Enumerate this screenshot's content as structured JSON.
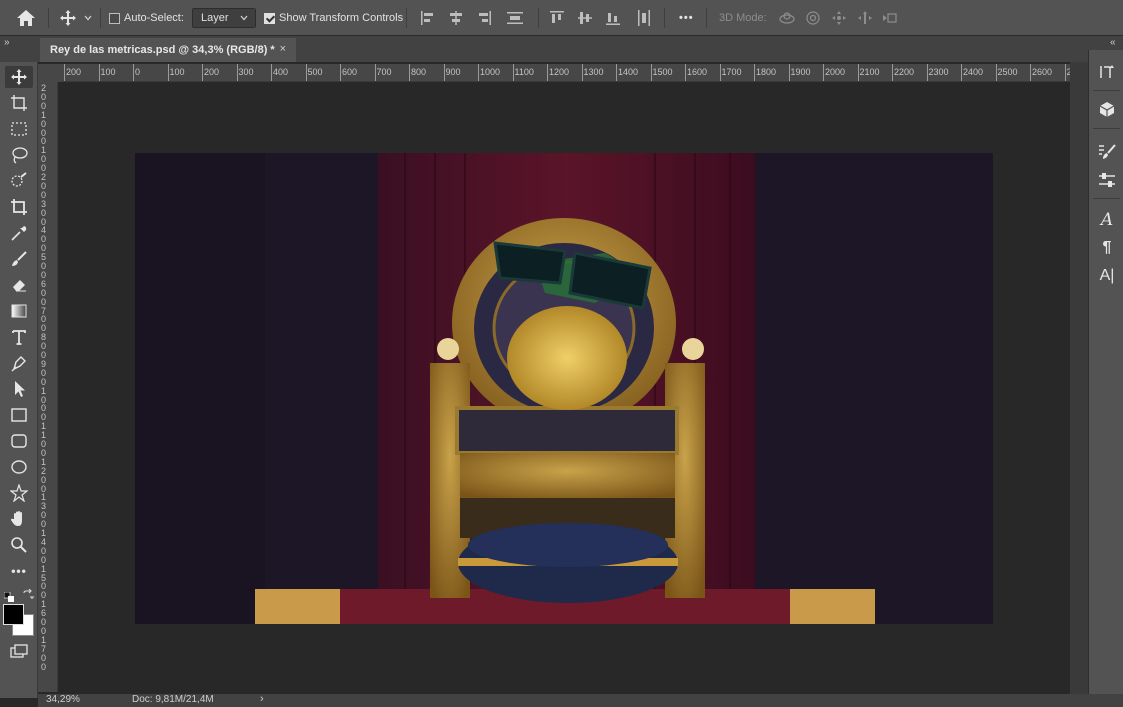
{
  "options_bar": {
    "auto_select_label": "Auto-Select:",
    "auto_select_checked": false,
    "target_select_value": "Layer",
    "show_transform_label": "Show Transform Controls",
    "show_transform_checked": true,
    "more_label": "•••",
    "mode_3d_label": "3D Mode:"
  },
  "document_tab": {
    "title": "Rey de las metricas.psd @ 34,3% (RGB/8) *",
    "close": "×"
  },
  "ruler_top_labels": [
    "200",
    "100",
    "0",
    "100",
    "200",
    "300",
    "400",
    "500",
    "600",
    "700",
    "800",
    "900",
    "1000",
    "1100",
    "1200",
    "1300",
    "1400",
    "1500",
    "1600",
    "1700",
    "1800",
    "1900",
    "2000",
    "2100",
    "2200",
    "2300",
    "2400",
    "2500",
    "2600",
    "2"
  ],
  "ruler_left_labels": [
    "2",
    "0",
    "0",
    "1",
    "0",
    "0",
    "0",
    "1",
    "0",
    "0",
    "2",
    "0",
    "0",
    "3",
    "0",
    "0",
    "4",
    "0",
    "0",
    "5",
    "0",
    "0",
    "6",
    "0",
    "0",
    "7",
    "0",
    "0",
    "8",
    "0",
    "0",
    "9",
    "0",
    "0",
    "1",
    "0",
    "0",
    "0",
    "1",
    "1",
    "0",
    "0",
    "1",
    "2",
    "0",
    "0",
    "1",
    "3",
    "0",
    "0",
    "1",
    "4",
    "0",
    "0",
    "1",
    "5",
    "0",
    "0",
    "1",
    "6",
    "0",
    "0",
    "1",
    "7",
    "0",
    "0"
  ],
  "status_bar": {
    "zoom": "34,29%",
    "doc_info": "Doc: 9,81M/21,4M",
    "arrow": "›"
  },
  "tools": [
    "move-tool",
    "artboard-tool",
    "marquee-tool",
    "lasso-tool",
    "quick-select-tool",
    "crop-tool",
    "eyedropper-tool",
    "brush-tool",
    "eraser-tool",
    "gradient-tool",
    "type-tool",
    "pen-tool",
    "path-select-tool",
    "rectangle-tool",
    "rounded-rect-tool",
    "ellipse-tool",
    "custom-shape-tool",
    "hand-tool",
    "zoom-tool",
    "more-tools"
  ],
  "colors": {
    "foreground": "#000000",
    "background": "#ffffff"
  }
}
